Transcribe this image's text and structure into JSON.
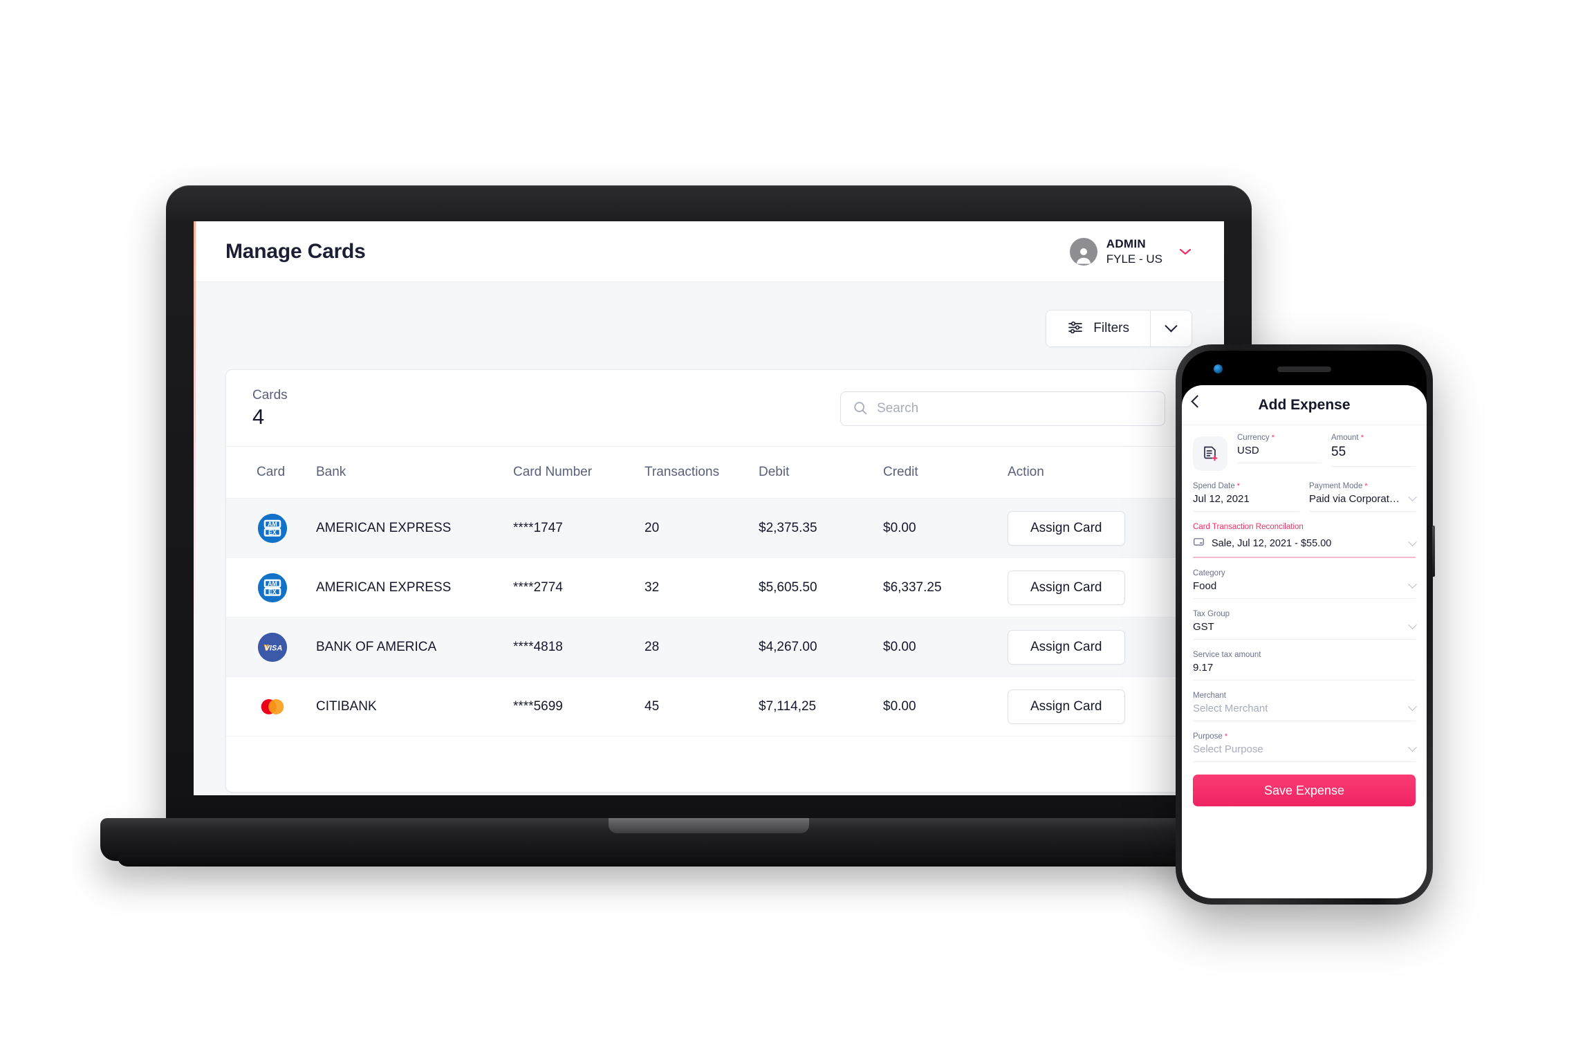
{
  "web": {
    "header": {
      "page_title": "Manage Cards",
      "admin_name": "ADMIN",
      "admin_org": "FYLE - US",
      "avatar_icon": "user-avatar-icon",
      "chevron_icon": "chevron-down-icon"
    },
    "toolbar": {
      "filters_label": "Filters",
      "filters_icon": "sliders-icon",
      "filters_caret_icon": "chevron-down-icon"
    },
    "panel": {
      "kpi_label": "Cards",
      "kpi_value": "4",
      "search_placeholder": "Search",
      "search_value": "",
      "search_icon": "search-icon"
    },
    "table": {
      "columns": [
        "Card",
        "Bank",
        "Card Number",
        "Transactions",
        "Debit",
        "Credit",
        "Action"
      ],
      "rows": [
        {
          "brand": "amex",
          "bank": "AMERICAN EXPRESS",
          "card_number": "****1747",
          "transactions": "20",
          "debit": "$2,375.35",
          "credit": "$0.00",
          "action": "Assign Card"
        },
        {
          "brand": "amex",
          "bank": "AMERICAN EXPRESS",
          "card_number": "****2774",
          "transactions": "32",
          "debit": "$5,605.50",
          "credit": "$6,337.25",
          "action": "Assign Card"
        },
        {
          "brand": "visa",
          "bank": "BANK OF AMERICA",
          "card_number": "****4818",
          "transactions": "28",
          "debit": "$4,267.00",
          "credit": "$0.00",
          "action": "Assign Card"
        },
        {
          "brand": "mastercard",
          "bank": "CITIBANK",
          "card_number": "****5699",
          "transactions": "45",
          "debit": "$7,114,25",
          "credit": "$0.00",
          "action": "Assign Card"
        }
      ]
    }
  },
  "phone": {
    "title": "Add Expense",
    "back_icon": "chevron-left-icon",
    "receipt_icon": "receipt-add-icon",
    "currency": {
      "label": "Currency",
      "required": true,
      "value": "USD"
    },
    "amount": {
      "label": "Amount",
      "required": true,
      "value": "55"
    },
    "spend_date": {
      "label": "Spend Date",
      "required": true,
      "value": "Jul 12, 2021"
    },
    "payment_mode": {
      "label": "Payment Mode",
      "required": true,
      "value": "Paid via Corporate Card"
    },
    "reconciliation": {
      "label": "Card Transaction Reconcilation",
      "value": "Sale, Jul 12, 2021 - $55.00",
      "icon": "credit-card-icon"
    },
    "category": {
      "label": "Category",
      "value": "Food"
    },
    "tax_group": {
      "label": "Tax Group",
      "value": "GST"
    },
    "service_tax": {
      "label": "Service tax amount",
      "value": "9.17"
    },
    "merchant": {
      "label": "Merchant",
      "placeholder": "Select Merchant"
    },
    "purpose": {
      "label": "Purpose",
      "required": true,
      "placeholder": "Select Purpose"
    },
    "save_label": "Save Expense"
  },
  "colors": {
    "accent_pink": "#f02e65",
    "amex_blue": "#1272c8",
    "visa_blue": "#3c58a8",
    "mc_red": "#eb001b",
    "mc_orange": "#f79e1b",
    "text_dark": "#15172b",
    "text_muted": "#5a5f7a"
  }
}
